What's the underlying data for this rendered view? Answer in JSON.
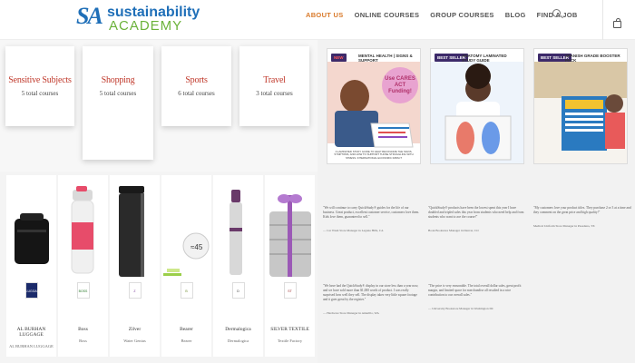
{
  "header": {
    "logo_mark": "SA",
    "logo_line1": "sustainability",
    "logo_line2": "ACADEMY",
    "nav": [
      "ABOUT US",
      "ONLINE COURSES",
      "GROUP COURSES",
      "BLOG",
      "FIND A JOB"
    ],
    "active_nav": "ABOUT US",
    "icons": [
      "search-icon",
      "bag-icon"
    ]
  },
  "categories": [
    {
      "title": "Sensitive Subjects",
      "count": "5 total courses"
    },
    {
      "title": "Shopping",
      "count": "5 total courses"
    },
    {
      "title": "Sports",
      "count": "6 total courses"
    },
    {
      "title": "Travel",
      "count": "3 total courses"
    }
  ],
  "products": [
    {
      "name": "AL BURHAN LUGGAGE",
      "sub": "AL BURHAN LUGGAGE",
      "logo": "LUGGAGE"
    },
    {
      "name": "Boss",
      "sub": "Boss",
      "logo": "BOSS"
    },
    {
      "name": "Zilver",
      "sub": "Water Genius",
      "logo": "Z"
    },
    {
      "name": "Bearer",
      "sub": "Bearer",
      "logo": "B"
    },
    {
      "name": "Dermalogica",
      "sub": "Dermalogica",
      "logo": "D"
    },
    {
      "name": "SILVER TEXTILE",
      "sub": "Textile Factory",
      "logo": "ST"
    }
  ],
  "banners": [
    {
      "tag_new": "NEW",
      "title": "MENTAL HEALTH | SIGNS & SUPPORT",
      "sticker": "Use CARES ACT Funding!",
      "note": "A LAMINATED STUDY GUIDE TO HELP RECOGNIZE THE SIGNS, SYMPTOMS, AND HOW TO SUPPORT THOSE STRUGGLING WITH STRESS. INTERNATIONAL ECONOMIC IMPACT"
    },
    {
      "tag_new": "BEST SELLER",
      "title": "ANATOMY LAMINATED STUDY GUIDE",
      "sticker": "",
      "note": ""
    },
    {
      "tag_new": "BEST SELLER",
      "title": "SPANISH GRADE BOOSTER PACK",
      "sticker": "",
      "note": ""
    }
  ],
  "testimonials": [
    {
      "quote": "\"We will continue to carry QuickStudy® guides for the life of our business. Great product, excellent customer service, customers love them. Kids love them, guaranteed to sell.\"",
      "author": "— Car Wash Store Manager in Laguna Hills, CA"
    },
    {
      "quote": "\"QuickStudy® products have been the lowest spent this year I have doubled and tripled sales this year from students who need help and from students who want to ace the course!\"",
      "author": "Book Bookstore Manager in Denver, CO"
    },
    {
      "quote": "\"My customers love your product titles. They purchase 2 or 3 at a time and they comment on the great price and high quality!\"",
      "author": "Medical Uniform Store Manager in Pasadena, TX"
    },
    {
      "quote": "\"We have had the QuickStudy® display in our store less than a year now, and we have sold more than $1,000 worth of product. I was really surprised how well they sell. The display takes very little square footage and it goes great by the register.\"",
      "author": "— Hardware Store Manager in Amarillo, WA"
    },
    {
      "quote": "\"The price is very reasonable. The total overall dollar sales, great profit margin, and limited space for merchandise all resulted in a nice contribution to our overall sales.\"",
      "author": "— University Bookstore Manager in Washington DC"
    }
  ],
  "colors": {
    "accent": "#d97a2b",
    "brand_blue": "#1f6fb8",
    "brand_green": "#6bb23a",
    "category_red": "#c0392b"
  }
}
